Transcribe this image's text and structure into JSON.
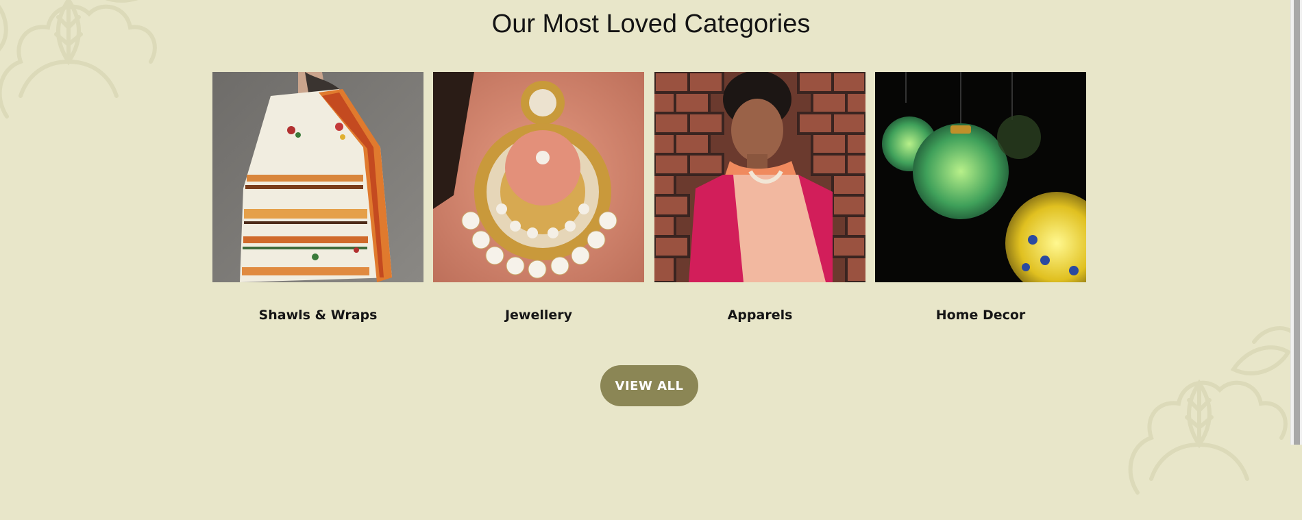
{
  "section": {
    "title": "Our Most Loved Categories"
  },
  "categories": [
    {
      "label": "Shawls & Wraps",
      "image": "woman-wearing-embroidered-shawl"
    },
    {
      "label": "Jewellery",
      "image": "kundan-pearl-earring"
    },
    {
      "label": "Apparels",
      "image": "woman-in-silk-saree"
    },
    {
      "label": "Home Decor",
      "image": "mosaic-glass-lanterns"
    }
  ],
  "cta": {
    "label": "VIEW ALL"
  },
  "colors": {
    "background": "#e8e6c9",
    "button": "#8b8655",
    "button_text": "#ffffff",
    "text": "#151515",
    "ornament": "#dcdab9"
  }
}
